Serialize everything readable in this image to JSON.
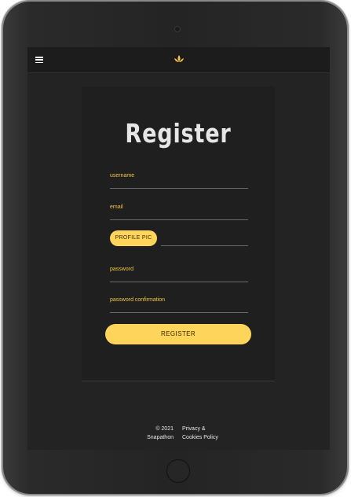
{
  "header": {
    "menu_icon": "hamburger-menu-icon",
    "logo_icon": "lotus-logo-icon",
    "accent_color": "#ffd45a"
  },
  "form": {
    "title": "Register",
    "username_label": "username",
    "email_label": "email",
    "profile_pic_button": "PROFILE PIC",
    "password_label": "password",
    "password_confirmation_label": "password confirmation",
    "register_button": "REGISTER"
  },
  "footer": {
    "copyright_line1": "© 2021",
    "copyright_line2": "Snapathon",
    "policy_line1": "Privacy &",
    "policy_line2": "Cookies Policy"
  }
}
